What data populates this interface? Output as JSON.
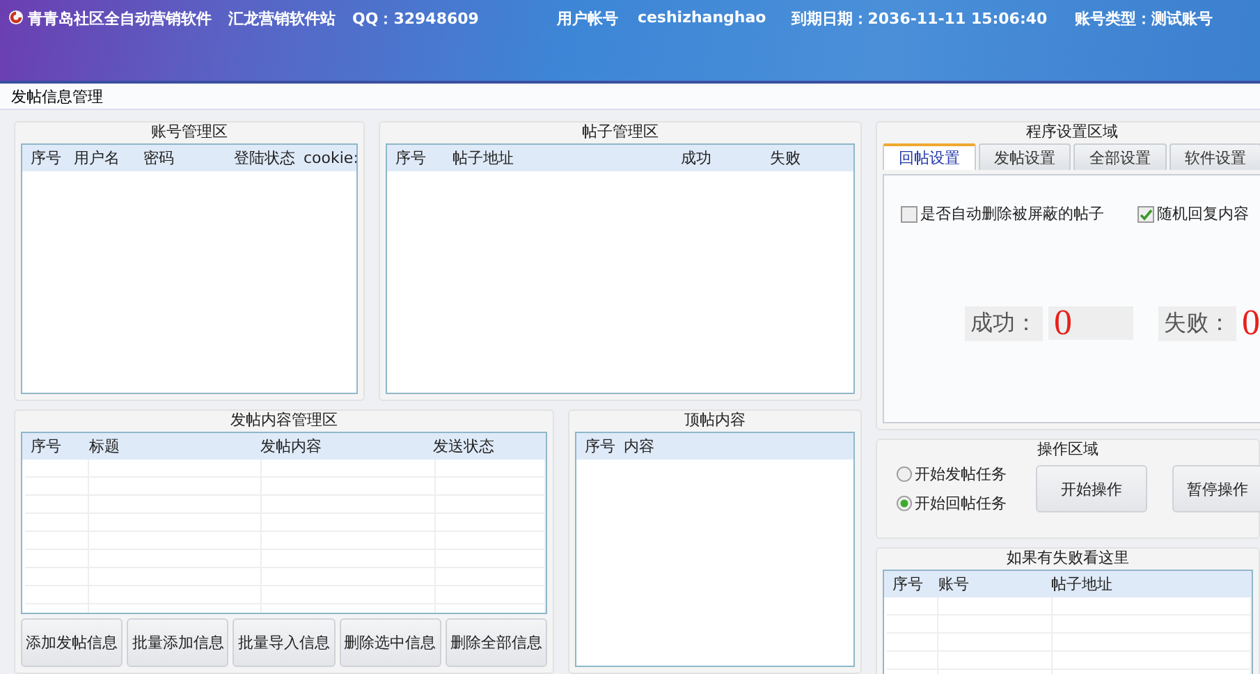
{
  "title_bar": {
    "app_name": "青青岛社区全自动营销软件",
    "site": "汇龙营销软件站",
    "qq": "QQ：32948609",
    "user_label": "用户帐号",
    "user": "ceshizhanghao",
    "expiry": "到期日期：2036-11-11 15:06:40",
    "account_type": "账号类型：测试账号"
  },
  "page_tab": "发帖信息管理",
  "account_area": {
    "title": "账号管理区",
    "gridlines": false,
    "columns": [
      "序号",
      "用户名",
      "密码",
      "登陆状态",
      "cookie:"
    ]
  },
  "post_area": {
    "title": "帖子管理区",
    "gridlines": false,
    "columns": [
      "序号",
      "帖子地址",
      "成功",
      "失败"
    ]
  },
  "content_area": {
    "title": "发帖内容管理区",
    "gridlines": true,
    "columns": [
      "序号",
      "标题",
      "发帖内容",
      "发送状态"
    ],
    "buttons": [
      "添加发帖信息",
      "批量添加信息",
      "批量导入信息",
      "删除选中信息",
      "删除全部信息"
    ]
  },
  "bump_area": {
    "title": "顶帖内容",
    "gridlines": false,
    "columns": [
      "序号",
      "内容"
    ]
  },
  "settings": {
    "title": "程序设置区域",
    "tabs": [
      {
        "label": "回帖设置",
        "selected": true
      },
      {
        "label": "发帖设置",
        "selected": false
      },
      {
        "label": "全部设置",
        "selected": false
      },
      {
        "label": "软件设置",
        "selected": false
      }
    ],
    "options": [
      {
        "label": "是否自动删除被屏蔽的帖子",
        "checked": false
      },
      {
        "label": "随机回复内容",
        "checked": true
      }
    ],
    "success_label": "成功：",
    "success_value": "0",
    "fail_label": "失败：",
    "fail_value": "0"
  },
  "operations": {
    "title": "操作区域",
    "modes": [
      {
        "label": "开始发帖任务",
        "selected": false
      },
      {
        "label": "开始回帖任务",
        "selected": true
      }
    ],
    "buttons": [
      "开始操作",
      "暂停操作"
    ]
  },
  "failures": {
    "title": "如果有失败看这里",
    "gridlines": true,
    "columns": [
      "序号",
      "账号",
      "帖子地址"
    ]
  }
}
